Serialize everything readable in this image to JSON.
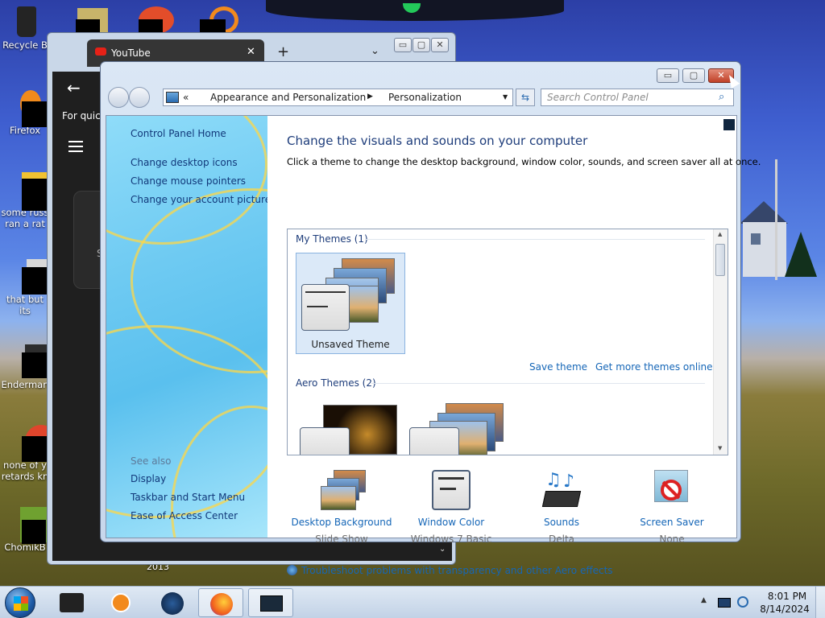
{
  "desktop": {
    "icons": [
      {
        "label": "Recycle B",
        "icon": "recycle-bin-icon"
      },
      {
        "label": "Firefox",
        "icon": "firefox-icon"
      },
      {
        "label": "some russ ran a rat",
        "icon": "file-icon"
      },
      {
        "label": "that but its",
        "icon": "file-icon"
      },
      {
        "label": "Enderman",
        "icon": "file-icon"
      },
      {
        "label": "none of y retards kn",
        "icon": "file-icon"
      },
      {
        "label": "ChomikB",
        "icon": "file-icon"
      }
    ],
    "stray_text": "2013"
  },
  "browser": {
    "tab_title": "YouTube",
    "new_tab": "+",
    "content_text": "For quick",
    "partial_letter": "S"
  },
  "control_panel": {
    "breadcrumb": {
      "prefix": "«",
      "items": [
        "Appearance and Personalization",
        "Personalization"
      ]
    },
    "search": {
      "placeholder": "Search Control Panel"
    },
    "left_links": [
      "Control Panel Home",
      "Change desktop icons",
      "Change mouse pointers",
      "Change your account picture"
    ],
    "see_also": {
      "heading": "See also",
      "links": [
        "Display",
        "Taskbar and Start Menu",
        "Ease of Access Center"
      ]
    },
    "title": "Change the visuals and sounds on your computer",
    "subtitle": "Click a theme to change the desktop background, window color, sounds, and screen saver all at once.",
    "my_themes": {
      "heading": "My Themes (1)",
      "selected": "Unsaved Theme",
      "save": "Save theme",
      "more": "Get more themes online"
    },
    "aero_themes": {
      "heading": "Aero Themes (2)"
    },
    "bottom": [
      {
        "label": "Desktop Background",
        "value": "Slide Show",
        "icon": "desktop-background-icon"
      },
      {
        "label": "Window Color",
        "value": "Windows 7 Basic",
        "icon": "window-color-icon"
      },
      {
        "label": "Sounds",
        "value": "Delta",
        "icon": "sounds-icon"
      },
      {
        "label": "Screen Saver",
        "value": "None",
        "icon": "screen-saver-icon"
      }
    ],
    "troubleshoot": "Troubleshoot problems with transparency and other Aero effects"
  },
  "taskbar": {
    "time": "8:01 PM",
    "date": "8/14/2024"
  }
}
